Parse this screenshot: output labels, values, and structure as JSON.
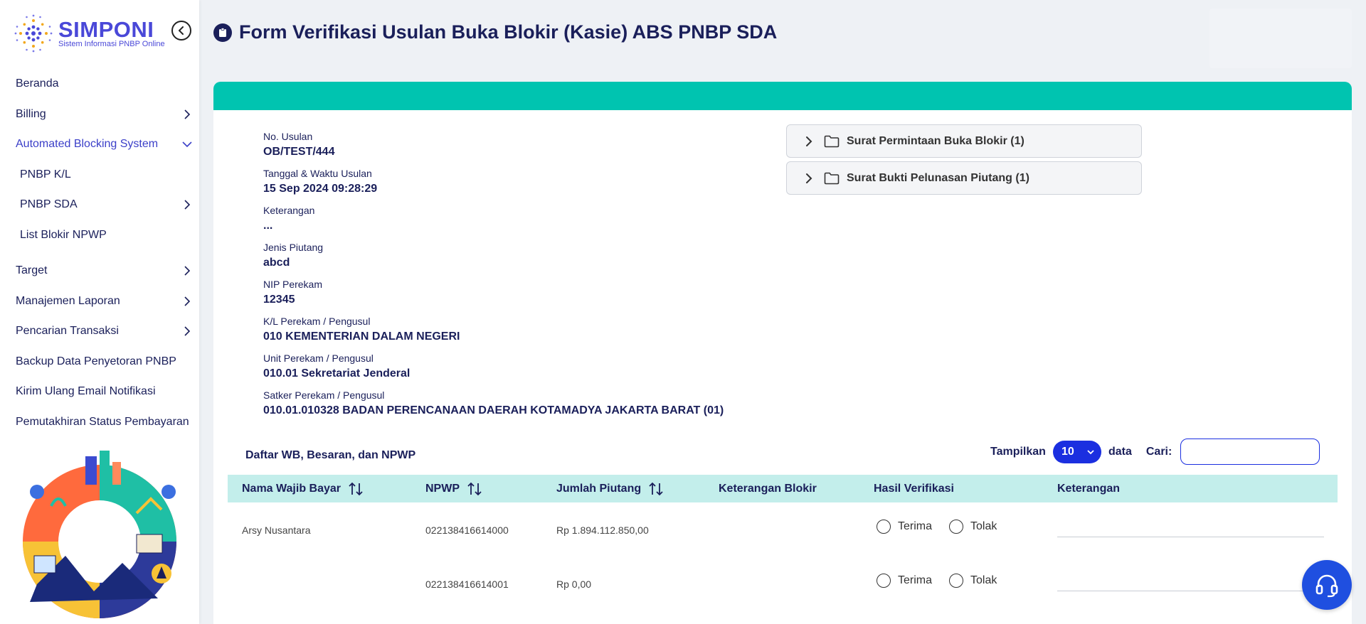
{
  "brand": {
    "name": "SIMPONI",
    "subtitle": "Sistem Informasi PNBP Online"
  },
  "sidebar": {
    "items": [
      {
        "label": "Beranda",
        "has_arrow": false
      },
      {
        "label": "Billing",
        "has_arrow": true
      },
      {
        "label": "Automated Blocking System",
        "has_arrow": true,
        "expanded": true
      },
      {
        "label": "PNBP K/L",
        "has_arrow": false,
        "sub": true
      },
      {
        "label": "PNBP SDA",
        "has_arrow": true,
        "sub": true
      },
      {
        "label": "List Blokir NPWP",
        "has_arrow": false,
        "sub": true
      },
      {
        "label": "Target",
        "has_arrow": true
      },
      {
        "label": "Manajemen Laporan",
        "has_arrow": true
      },
      {
        "label": "Pencarian Transaksi",
        "has_arrow": true
      },
      {
        "label": "Backup Data Penyetoran PNBP",
        "has_arrow": false
      },
      {
        "label": "Kirim Ulang Email Notifikasi",
        "has_arrow": false
      },
      {
        "label": "Pemutakhiran Status Pembayaran",
        "has_arrow": false
      }
    ]
  },
  "header": {
    "title": "Form Verifikasi Usulan Buka Blokir (Kasie) ABS PNBP SDA"
  },
  "details": {
    "fields": [
      {
        "label": "No. Usulan",
        "value": "OB/TEST/444"
      },
      {
        "label": "Tanggal & Waktu Usulan",
        "value": "15 Sep 2024 09:28:29"
      },
      {
        "label": "Keterangan",
        "value": "..."
      },
      {
        "label": "Jenis Piutang",
        "value": "abcd"
      },
      {
        "label": "NIP Perekam",
        "value": "12345"
      },
      {
        "label": "K/L Perekam / Pengusul",
        "value": "010 KEMENTERIAN DALAM NEGERI"
      },
      {
        "label": "Unit Perekam / Pengusul",
        "value": "010.01 Sekretariat Jenderal"
      },
      {
        "label": "Satker Perekam / Pengusul",
        "value": "010.01.010328 BADAN PERENCANAAN DAERAH KOTAMADYA JAKARTA BARAT (01)"
      }
    ]
  },
  "attachments": [
    {
      "label": "Surat Permintaan Buka Blokir (1)"
    },
    {
      "label": "Surat Bukti Pelunasan Piutang (1)"
    }
  ],
  "list": {
    "title": "Daftar WB, Besaran, dan NPWP",
    "show_label": "Tampilkan",
    "show_value": "10",
    "show_suffix": "data",
    "search_label": "Cari:",
    "search_value": ""
  },
  "table": {
    "columns": [
      "Nama Wajib Bayar",
      "NPWP",
      "Jumlah Piutang",
      "Keterangan Blokir",
      "Hasil Verifikasi",
      "Keterangan"
    ],
    "accept_label": "Terima",
    "reject_label": "Tolak",
    "rows": [
      {
        "nama": "Arsy Nusantara",
        "npwp": "022138416614000",
        "jumlah": "Rp 1.894.112.850,00",
        "ket_blokir": "",
        "keterangan": ""
      },
      {
        "nama": "",
        "npwp": "022138416614001",
        "jumlah": "Rp 0,00",
        "ket_blokir": "",
        "keterangan": ""
      }
    ]
  },
  "colors": {
    "accent": "#00c4b0",
    "primary": "#1b2fe0",
    "brand": "#4a48d8",
    "text": "#1a1f5a"
  }
}
